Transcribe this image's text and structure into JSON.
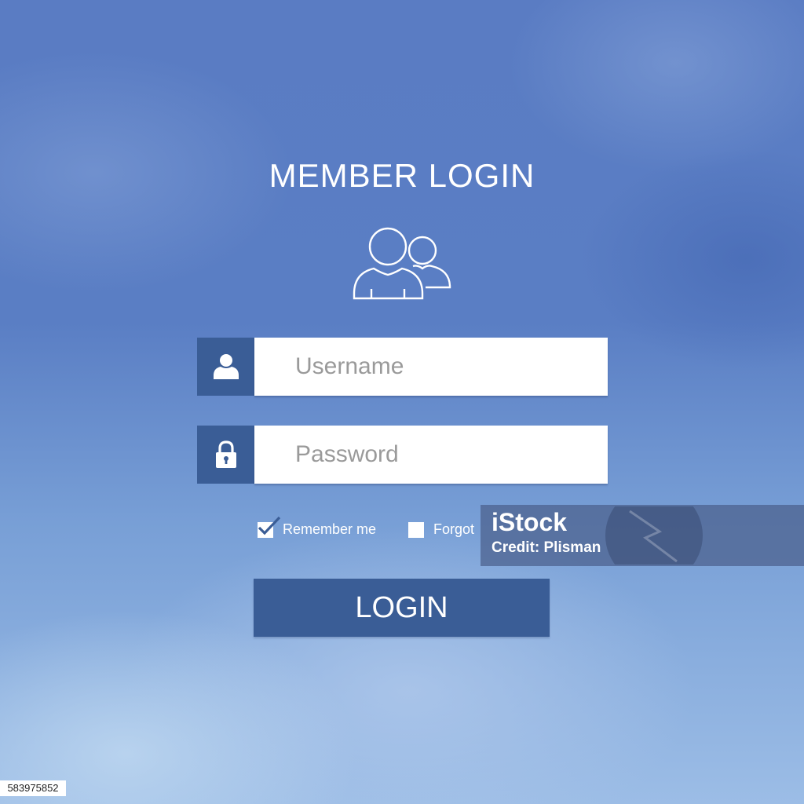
{
  "header": {
    "title": "MEMBER LOGIN"
  },
  "icons": {
    "header": "users-group-icon",
    "username": "user-icon",
    "password": "lock-icon",
    "remember": "checkmark-icon"
  },
  "form": {
    "username": {
      "placeholder": "Username",
      "value": ""
    },
    "password": {
      "placeholder": "Password",
      "value": ""
    },
    "remember_label": "Remember me",
    "remember_checked": true,
    "forgot_label": "Forgot password?",
    "forgot_visible_text": "Forgot",
    "submit_label": "LOGIN"
  },
  "watermark": {
    "brand": "iStock",
    "credit": "Credit: Plisman"
  },
  "image_id": "583975852",
  "colors": {
    "accent": "#3a5d96",
    "text_light": "#ffffff",
    "placeholder": "#9a9a9a"
  }
}
